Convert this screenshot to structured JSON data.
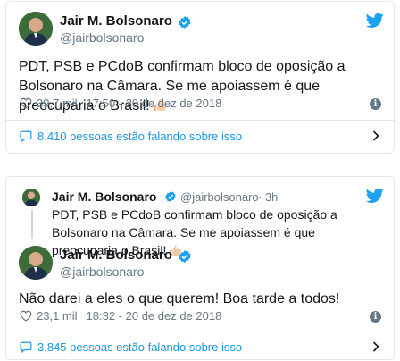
{
  "tweet1": {
    "author_name": "Jair M. Bolsonaro",
    "author_handle": "@jairbolsonaro",
    "text": "PDT, PSB e PCdoB confirmam bloco de oposição a Bolsonaro na Câmara. Se me apoiassem é que preocuparia o Brasil!",
    "emoji": "thumbs-up-emoji",
    "likes": "39,7 mil",
    "timestamp": "17:50 - 20 de dez de 2018",
    "conversation_link": "8.410 pessoas estão falando sobre isso"
  },
  "tweet2": {
    "quoted": {
      "author_name": "Jair M. Bolsonaro",
      "author_handle": "@jairbolsonaro",
      "age": "· 3h",
      "text": "PDT, PSB e PCdoB confirmam bloco de oposição a Bolsonaro na Câmara. Se me apoiassem é que preocuparia o Brasil!",
      "emoji": "thumbs-up-emoji"
    },
    "author_name": "Jair M. Bolsonaro",
    "author_handle": "@jairbolsonaro",
    "text": "Não darei a eles o que querem! Boa tarde a todos!",
    "likes": "23,1 mil",
    "timestamp": "18:32 - 20 de dez de 2018",
    "conversation_link": "3.845 pessoas estão falando sobre isso"
  },
  "icons": {
    "brand": "twitter-bird-icon",
    "verified": "verified-badge-icon",
    "like": "heart-icon",
    "info": "info-icon",
    "reply": "speech-bubble-icon",
    "more": "chevron-right-icon"
  },
  "colors": {
    "twitter_blue": "#1da1f2",
    "link_blue": "#1b95e0",
    "text": "#14171a",
    "secondary": "#657786",
    "border": "#e1e8ed"
  }
}
